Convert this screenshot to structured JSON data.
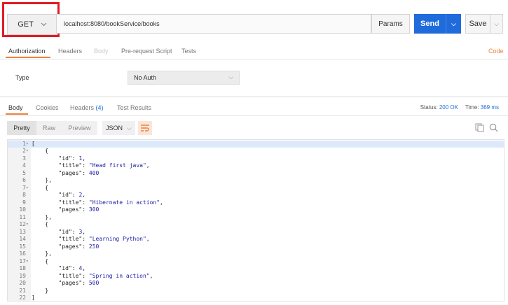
{
  "request": {
    "method": "GET",
    "url": "localhost:8080/bookService/books",
    "params_label": "Params",
    "send_label": "Send",
    "save_label": "Save"
  },
  "request_tabs": {
    "items": [
      "Authorization",
      "Headers",
      "Body",
      "Pre-request Script",
      "Tests"
    ],
    "active": "Authorization",
    "code_link": "Code"
  },
  "auth": {
    "type_label": "Type",
    "selected": "No Auth"
  },
  "response_tabs": {
    "body": "Body",
    "cookies": "Cookies",
    "headers": "Headers",
    "headers_count": "(4)",
    "tests": "Test Results",
    "active": "Body"
  },
  "status": {
    "status_label": "Status:",
    "status_value": "200 OK",
    "time_label": "Time:",
    "time_value": "369 ms"
  },
  "view_modes": {
    "items": [
      "Pretty",
      "Raw",
      "Preview"
    ],
    "active": "Pretty",
    "format": "JSON"
  },
  "icons": [
    "chevron-down-icon",
    "wrap-lines-icon",
    "copy-icon",
    "search-icon"
  ],
  "colors": {
    "accent": "#f07f3c",
    "send_button": "#1f6bdb",
    "highlight_box": "#e11c24",
    "status_value": "#1f6bdb"
  },
  "response_lines": [
    {
      "n": "1",
      "t": "[",
      "fold": true
    },
    {
      "n": "2",
      "t": "    {",
      "fold": true
    },
    {
      "n": "3",
      "t": "        \"id\": 1,"
    },
    {
      "n": "4",
      "t": "        \"title\": \"Head first java\","
    },
    {
      "n": "5",
      "t": "        \"pages\": 400"
    },
    {
      "n": "6",
      "t": "    },"
    },
    {
      "n": "7",
      "t": "    {",
      "fold": true
    },
    {
      "n": "8",
      "t": "        \"id\": 2,"
    },
    {
      "n": "9",
      "t": "        \"title\": \"Hibernate in action\","
    },
    {
      "n": "10",
      "t": "        \"pages\": 300"
    },
    {
      "n": "11",
      "t": "    },"
    },
    {
      "n": "12",
      "t": "    {",
      "fold": true
    },
    {
      "n": "13",
      "t": "        \"id\": 3,"
    },
    {
      "n": "14",
      "t": "        \"title\": \"Learning Python\","
    },
    {
      "n": "15",
      "t": "        \"pages\": 250"
    },
    {
      "n": "16",
      "t": "    },"
    },
    {
      "n": "17",
      "t": "    {",
      "fold": true
    },
    {
      "n": "18",
      "t": "        \"id\": 4,"
    },
    {
      "n": "19",
      "t": "        \"title\": \"Spring in action\","
    },
    {
      "n": "20",
      "t": "        \"pages\": 500"
    },
    {
      "n": "21",
      "t": "    }"
    },
    {
      "n": "22",
      "t": "]"
    }
  ]
}
